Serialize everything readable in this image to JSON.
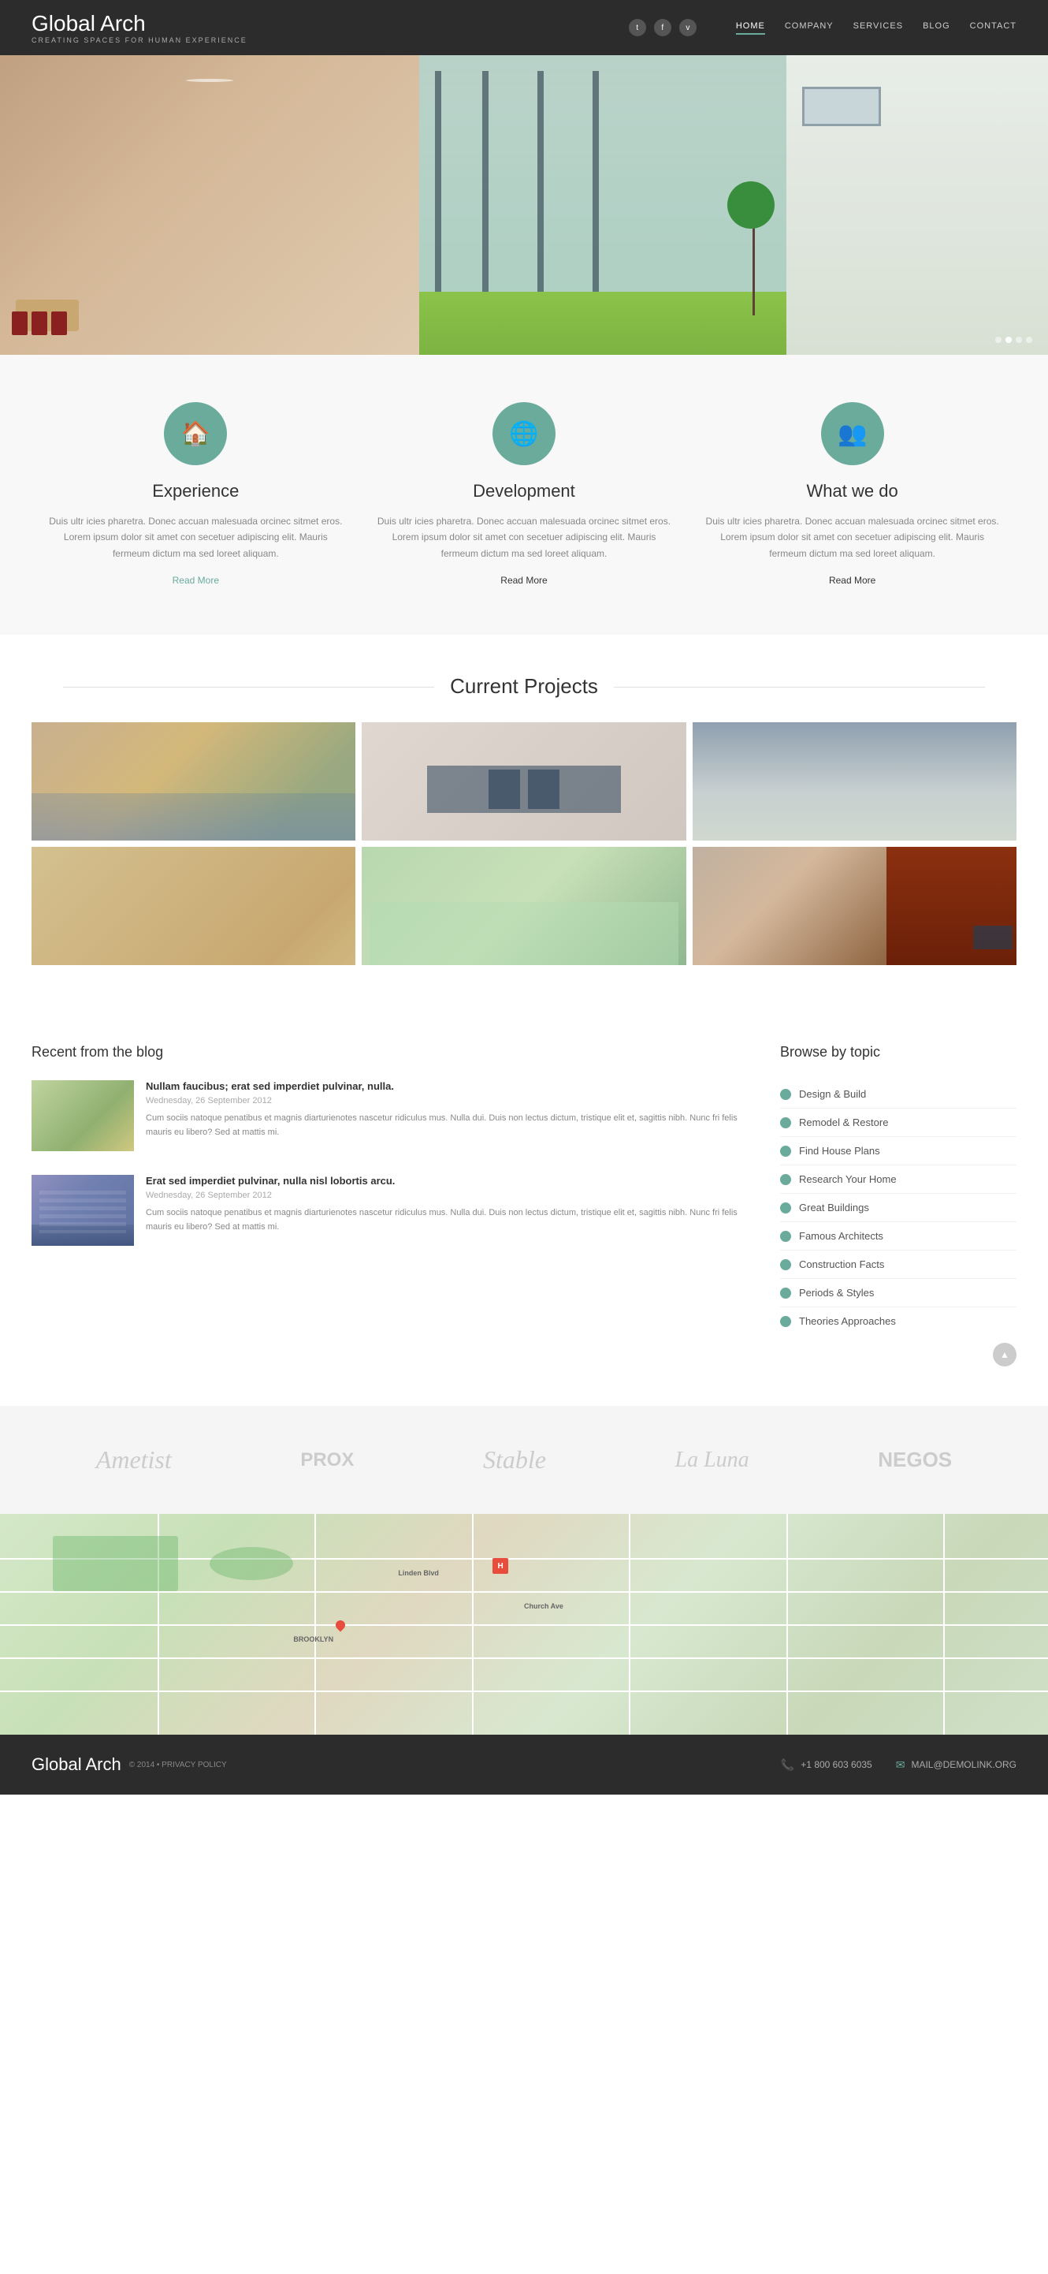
{
  "header": {
    "logo": "Global Arch",
    "tagline": "CREATING SPACES FOR HUMAN EXPERIENCE",
    "nav": [
      {
        "label": "HOME",
        "active": true
      },
      {
        "label": "COMPANY",
        "active": false
      },
      {
        "label": "SERVICES",
        "active": false
      },
      {
        "label": "BLOG",
        "active": false
      },
      {
        "label": "CONTACT",
        "active": false
      }
    ],
    "social": [
      "t",
      "f",
      "v"
    ]
  },
  "features": [
    {
      "icon": "🏠",
      "title": "Experience",
      "text": "Duis ultr icies pharetra. Donec accuan malesuada orcinec sitmet eros. Lorem ipsum dolor sit amet con secetuer adipiscing elit. Mauris fermeum dictum ma sed loreet aliquam.",
      "link": "Read More",
      "link_style": "teal"
    },
    {
      "icon": "🌐",
      "title": "Development",
      "text": "Duis ultr icies pharetra. Donec accuan malesuada orcinec sitmet eros. Lorem ipsum dolor sit amet con secetuer adipiscing elit. Mauris fermeum dictum ma sed loreet aliquam.",
      "link": "Read More",
      "link_style": "dark"
    },
    {
      "icon": "👥",
      "title": "What we do",
      "text": "Duis ultr icies pharetra. Donec accuan malesuada orcinec sitmet eros. Lorem ipsum dolor sit amet con secetuer adipiscing elit. Mauris fermeum dictum ma sed loreet aliquam.",
      "link": "Read More",
      "link_style": "dark"
    }
  ],
  "projects": {
    "title": "Current Projects"
  },
  "blog": {
    "title": "Recent from the blog",
    "posts": [
      {
        "title": "Nullam faucibus; erat sed imperdiet pulvinar, nulla.",
        "date": "Wednesday, 26 September 2012",
        "text": "Cum sociis natoque penatibus et magnis diarturienotes nascetur ridiculus mus. Nulla dui. Duis non lectus dictum, tristique elit et, sagittis nibh. Nunc fri felis mauris eu libero? Sed at mattis mi."
      },
      {
        "title": "Erat sed imperdiet pulvinar, nulla nisl lobortis arcu.",
        "date": "Wednesday, 26 September 2012",
        "text": "Cum sociis natoque penatibus et magnis diarturienotes nascetur ridiculus mus. Nulla dui. Duis non lectus dictum, tristique elit et, sagittis nibh. Nunc fri felis mauris eu libero? Sed at mattis mi."
      }
    ]
  },
  "topics": {
    "title": "Browse by topic",
    "items": [
      "Design & Build",
      "Remodel & Restore",
      "Find House Plans",
      "Research Your Home",
      "Great Buildings",
      "Famous Architects",
      "Construction Facts",
      "Periods & Styles",
      "Theories Approaches"
    ]
  },
  "partners": [
    {
      "name": "Ametist",
      "style": "italic"
    },
    {
      "name": "PROX",
      "style": "bold"
    },
    {
      "name": "Stable",
      "style": "italic"
    },
    {
      "name": "La Luna",
      "style": "italic"
    },
    {
      "name": "NEGOS",
      "style": "bold"
    }
  ],
  "footer": {
    "logo": "Global Arch",
    "copyright": "© 2014 • PRIVACY POLICY",
    "phone": "+1 800 603 6035",
    "email": "MAIL@DEMOLINK.ORG"
  }
}
